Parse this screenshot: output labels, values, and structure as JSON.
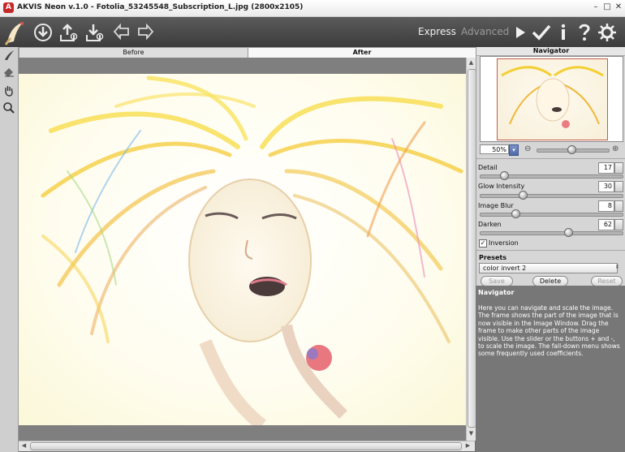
{
  "window": {
    "title": "AKVIS Neon v.1.0 - Fotolia_53245548_Subscription_L.jpg (2800x2105)",
    "minimize_glyph": "–",
    "maximize_glyph": "□",
    "close_glyph": "✕"
  },
  "toolbar": {
    "icons": [
      "open-image-icon",
      "save-image-icon",
      "batch-process-icon",
      "undo-icon",
      "redo-icon"
    ],
    "mode_express": "Express",
    "mode_advanced": "Advanced",
    "right_icons": [
      "run-icon",
      "apply-icon",
      "info-icon",
      "help-icon",
      "settings-icon"
    ]
  },
  "tools": [
    "brush-tool-icon",
    "eraser-tool-icon",
    "hand-tool-icon",
    "zoom-tool-icon"
  ],
  "tabs": {
    "before": "Before",
    "after": "After"
  },
  "navigator": {
    "title": "Navigator",
    "zoom": "50%",
    "zoom_out": "⊖",
    "zoom_in": "⊕",
    "zoom_level": 0.48
  },
  "params": [
    {
      "label": "Detail",
      "value": "17",
      "level": 0.17
    },
    {
      "label": "Glow Intensity",
      "value": "30",
      "level": 0.3
    },
    {
      "label": "Image Blur",
      "value": "8",
      "level": 0.25
    },
    {
      "label": "Darken",
      "value": "62",
      "level": 0.62
    }
  ],
  "inversion": {
    "label": "Inversion",
    "checked": true
  },
  "presets": {
    "title": "Presets",
    "selected": "color invert 2",
    "save": "Save",
    "delete": "Delete",
    "reset": "Reset"
  },
  "help": {
    "title": "Navigator",
    "text": "Here you can navigate and scale the image. The frame shows the part of the image that is now visible in the Image Window. Drag the frame to make other parts of the image visible. Use the slider or the buttons + and -, to scale the image. The fall-down menu shows some frequently used coefficients."
  },
  "colors": {
    "accent": "#c62828",
    "toolbar": "#4a4a4a",
    "panel": "#d6d6d6"
  }
}
